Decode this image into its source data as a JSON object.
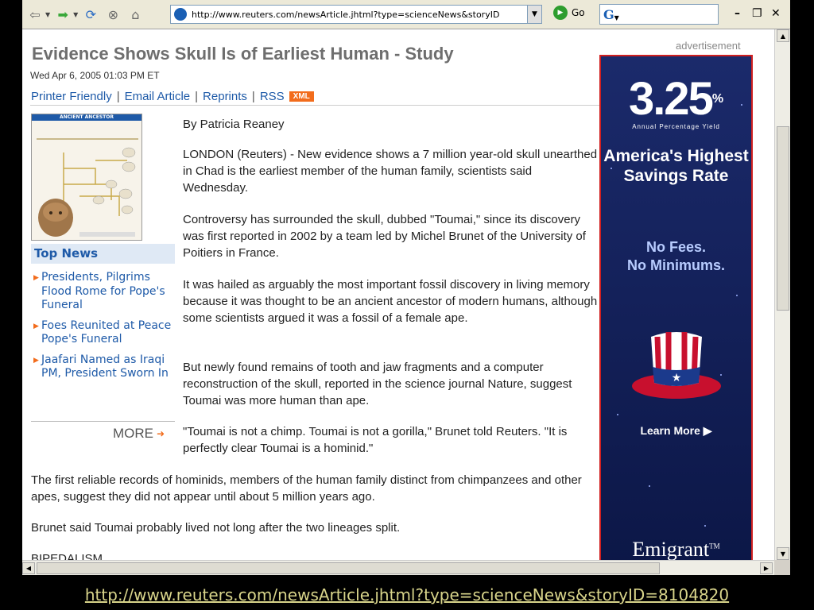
{
  "browser": {
    "address_url": "http://www.reuters.com/newsArticle.jhtml?type=scienceNews&storyID",
    "go_label": "Go",
    "controls": {
      "minimize": "–",
      "restore": "❐",
      "close": "✕"
    }
  },
  "article": {
    "headline": "Evidence Shows Skull Is of Earliest Human - Study",
    "dateline": "Wed Apr 6, 2005 01:03 PM ET",
    "tools": [
      "Printer Friendly",
      "Email Article",
      "Reprints",
      "RSS"
    ],
    "xml_badge": "XML",
    "byline": "By Patricia Reaney",
    "paragraphs": [
      "LONDON (Reuters) - New evidence shows a 7 million year-old skull unearthed in Chad is the earliest member of the human family, scientists said Wednesday.",
      "Controversy has surrounded the skull, dubbed \"Toumai,\" since its discovery was first reported in 2002 by a team led by Michel Brunet of the University of Poitiers in France.",
      "It was hailed as arguably the most important fossil discovery in living memory because it was thought to be an ancient ancestor of modern humans, although some scientists argued it was a fossil of a female ape.",
      "But newly found remains of tooth and jaw fragments and a computer reconstruction of the skull, reported in the science journal Nature, suggest Toumai was more human than ape.",
      "\"Toumai is not a chimp. Toumai is not a gorilla,\" Brunet told Reuters. \"It is perfectly clear Toumai is a hominid.\"",
      "The first reliable records of hominids, members of the human family distinct from chimpanzees and other apes, suggest they did not appear until about 5 million years ago.",
      "Brunet said Toumai probably lived not long after the two lineages split."
    ],
    "subhead": "BIPEDALISM",
    "graphic_title": "ANCIENT ANCESTOR"
  },
  "sidebar": {
    "heading": "Top News",
    "items": [
      "Presidents, Pilgrims Flood Rome for Pope's Funeral",
      "Foes Reunited at Peace Pope's Funeral",
      "Jaafari Named as Iraqi PM, President Sworn In"
    ],
    "more": "MORE"
  },
  "ad": {
    "label": "advertisement",
    "rate": "3.25",
    "rate_symbol": "%",
    "apy": "Annual Percentage Yield",
    "headline": "America's Highest Savings Rate",
    "fees_line1": "No Fees.",
    "fees_line2": "No Minimums.",
    "cta": "Learn More ▶",
    "brand": "Emigrant",
    "brand_tm": "TM",
    "colors": {
      "background": "#1b2a6b",
      "border": "#d02020"
    }
  },
  "footer": {
    "url": "http://www.reuters.com/newsArticle.jhtml?type=scienceNews&storyID=8104820"
  }
}
